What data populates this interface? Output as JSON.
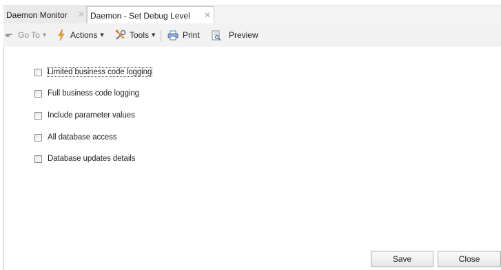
{
  "tabs": [
    {
      "label": "Daemon Monitor",
      "close": "✕",
      "active": false
    },
    {
      "label": "Daemon - Set Debug Level",
      "close": "✕",
      "active": true
    }
  ],
  "toolbar": {
    "goto_label": "Go To",
    "actions_label": "Actions",
    "tools_label": "Tools",
    "print_label": "Print",
    "preview_label": "Preview",
    "caret": "▼",
    "icons": {
      "goto": "pointing-hand-icon",
      "actions": "lightning-icon",
      "tools": "tools-icon",
      "print": "printer-icon",
      "preview": "preview-icon"
    }
  },
  "options": [
    {
      "label": "Limited business code logging",
      "checked": false,
      "focused": true
    },
    {
      "label": "Full business code logging",
      "checked": false
    },
    {
      "label": "Include parameter values",
      "checked": false
    },
    {
      "label": "All database access",
      "checked": false
    },
    {
      "label": "Database updates details",
      "checked": false
    }
  ],
  "buttons": {
    "save_label": "Save",
    "close_label": "Close"
  }
}
